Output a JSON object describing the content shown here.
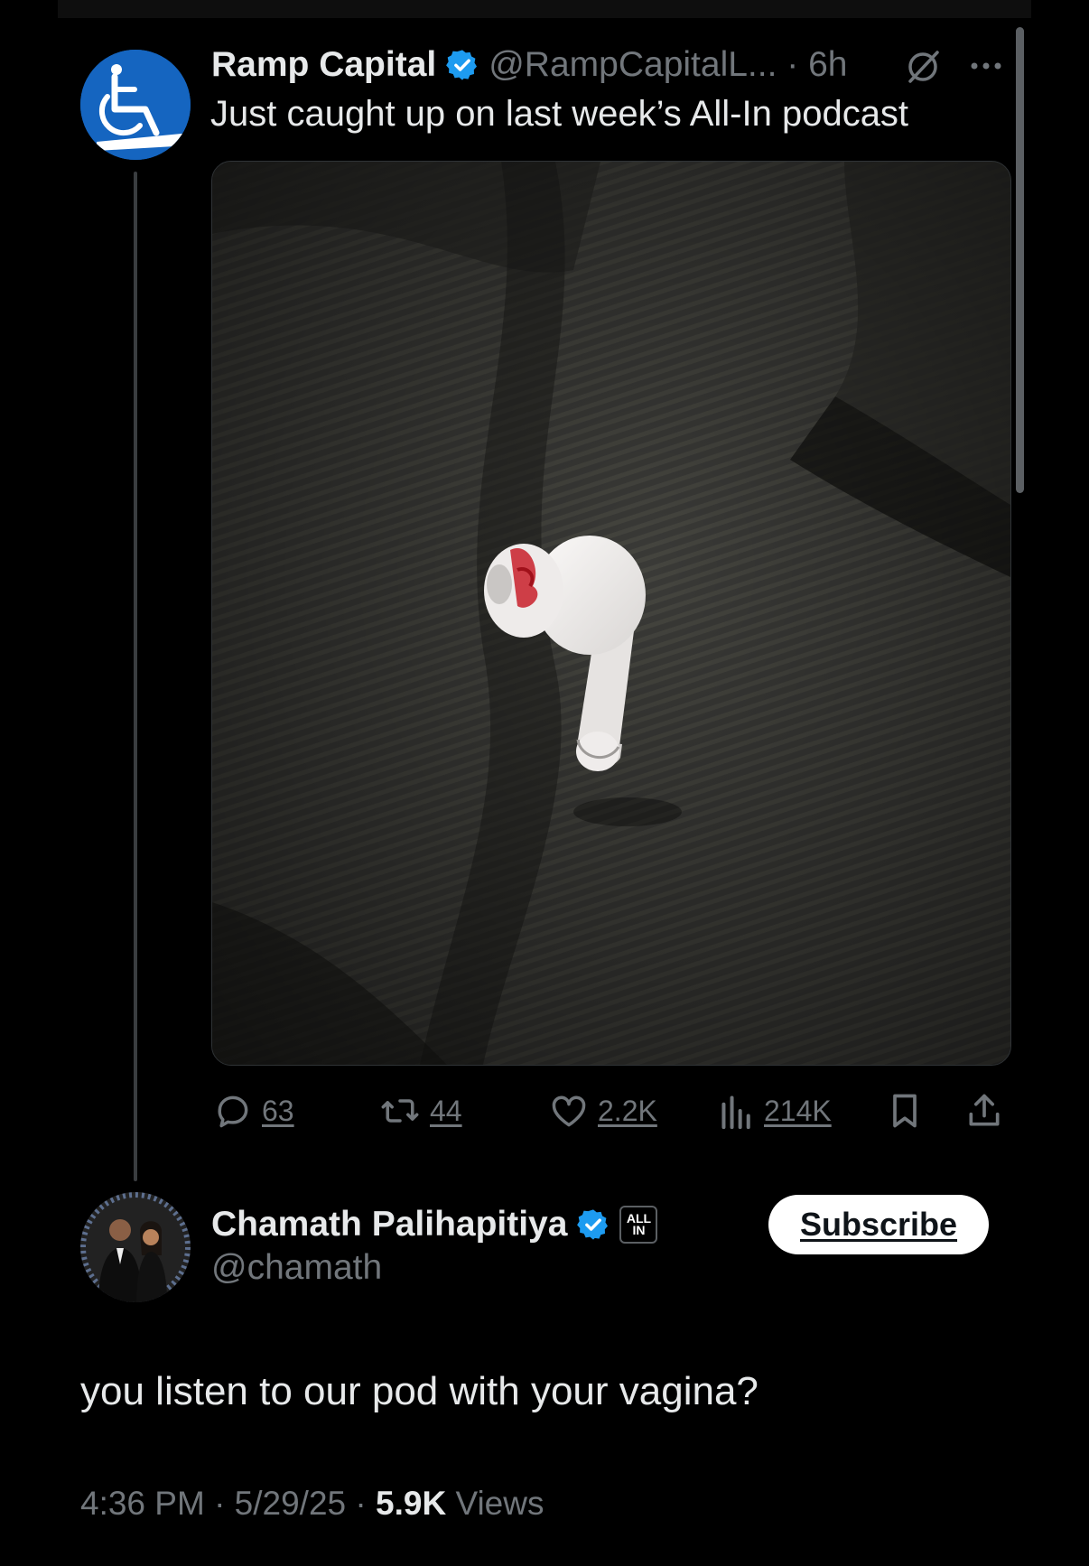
{
  "tweet": {
    "author_name": "Ramp Capital",
    "handle_time": "@RampCapitalL... · 6h",
    "text": "Just caught up on last week’s All-In podcast",
    "media_alt": "white earbud with red stain on dark ribbed fabric",
    "stats": {
      "replies": "63",
      "reposts": "44",
      "likes": "2.2K",
      "views": "214K"
    }
  },
  "reply": {
    "author_name": "Chamath Palihapitiya",
    "handle": "@chamath",
    "badge_line1": "ALL",
    "badge_line2": "IN",
    "subscribe_label": "Subscribe",
    "text": "you listen to our pod with your vagina?",
    "timestamp": "4:36 PM · 5/29/25 · ",
    "view_count": "5.9K",
    "views_label": " Views"
  },
  "icons": {
    "ramp_avatar": "wheelchair-icon",
    "verified": "verified-badge-icon",
    "grok": "grok-icon",
    "more": "more-dots-icon",
    "reply": "reply-icon",
    "repost": "repost-icon",
    "like": "heart-icon",
    "views": "analytics-icon",
    "bookmark": "bookmark-icon",
    "share": "share-icon"
  },
  "colors": {
    "background": "#000000",
    "text": "#e7e9ea",
    "muted": "#71767b",
    "verified": "#1d9bf0",
    "ramp_avatar": "#1565c0"
  }
}
